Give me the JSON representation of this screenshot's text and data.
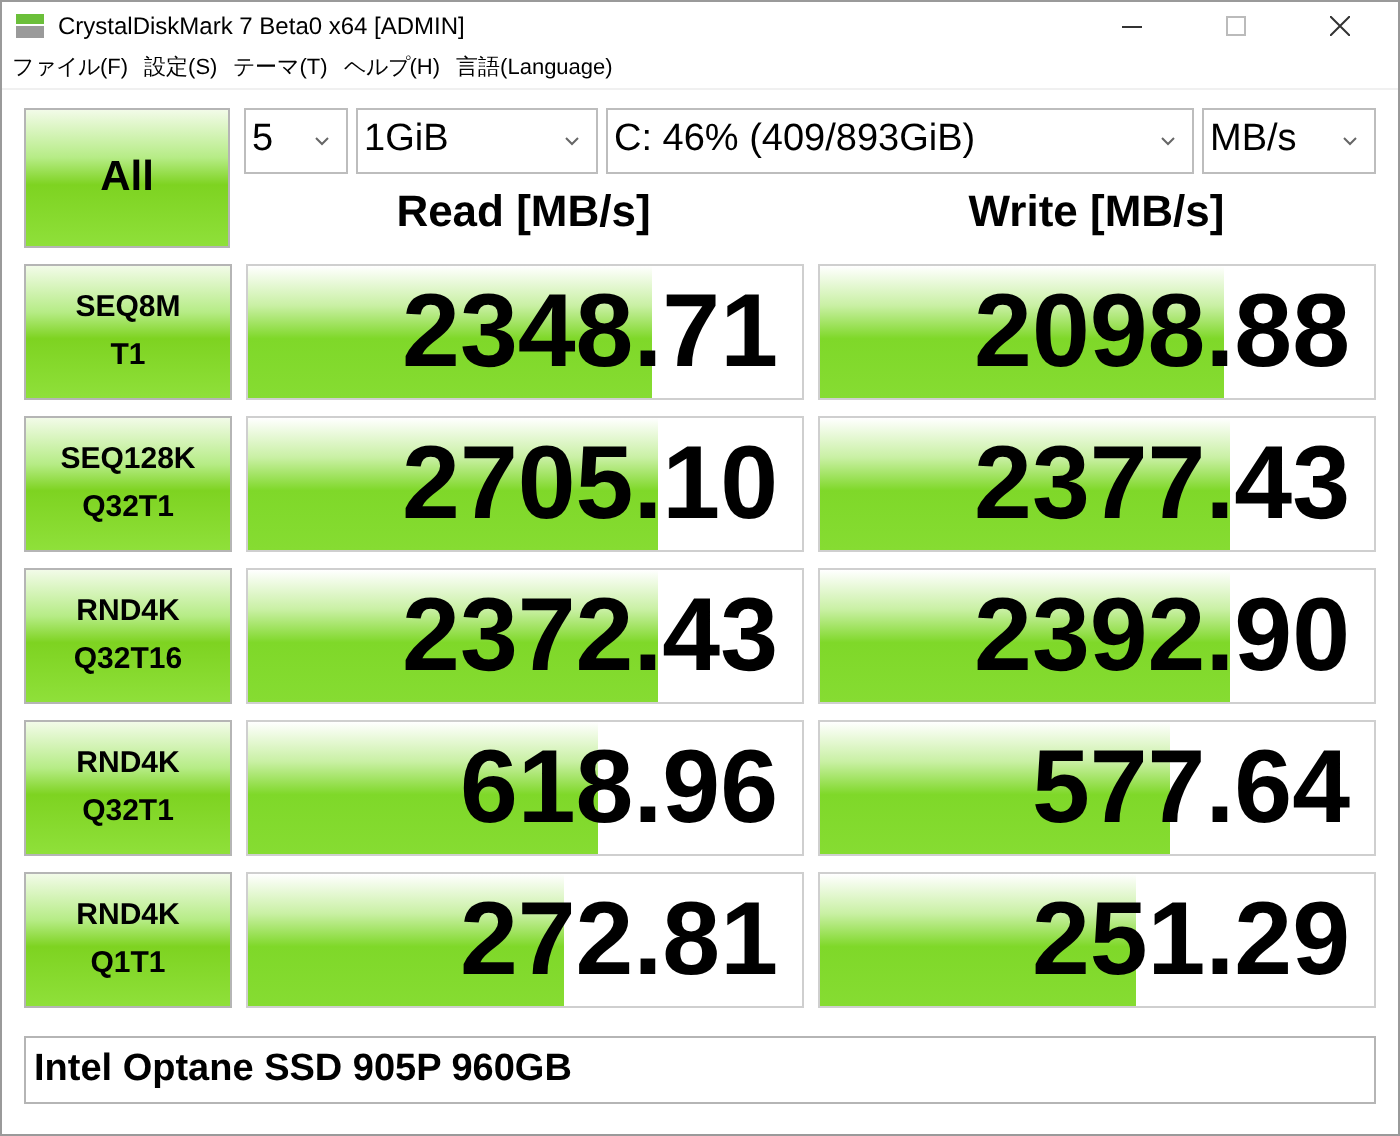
{
  "window": {
    "title": "CrystalDiskMark 7 Beta0 x64 [ADMIN]"
  },
  "menu": [
    "ファイル(F)",
    "設定(S)",
    "テーマ(T)",
    "ヘルプ(H)",
    "言語(Language)"
  ],
  "all_button": "All",
  "selects": [
    {
      "value": "5"
    },
    {
      "value": "1GiB"
    },
    {
      "value": "C: 46% (409/893GiB)"
    },
    {
      "value": "MB/s"
    }
  ],
  "headers": [
    "Read [MB/s]",
    "Write [MB/s]"
  ],
  "rows": [
    {
      "label": [
        "SEQ8M",
        "T1"
      ],
      "read": {
        "value": "2348.71",
        "level": 0.73
      },
      "write": {
        "value": "2098.88",
        "level": 0.73
      }
    },
    {
      "label": [
        "SEQ128K",
        "Q32T1"
      ],
      "read": {
        "value": "2705.10",
        "level": 0.74
      },
      "write": {
        "value": "2377.43",
        "level": 0.74
      }
    },
    {
      "label": [
        "RND4K",
        "Q32T16"
      ],
      "read": {
        "value": "2372.43",
        "level": 0.74
      },
      "write": {
        "value": "2392.90",
        "level": 0.74
      }
    },
    {
      "label": [
        "RND4K",
        "Q32T1"
      ],
      "read": {
        "value": "618.96",
        "level": 0.63
      },
      "write": {
        "value": "577.64",
        "level": 0.63
      }
    },
    {
      "label": [
        "RND4K",
        "Q1T1"
      ],
      "read": {
        "value": "272.81",
        "level": 0.57
      },
      "write": {
        "value": "251.29",
        "level": 0.57
      }
    }
  ],
  "comment": "Intel Optane SSD 905P 960GB"
}
